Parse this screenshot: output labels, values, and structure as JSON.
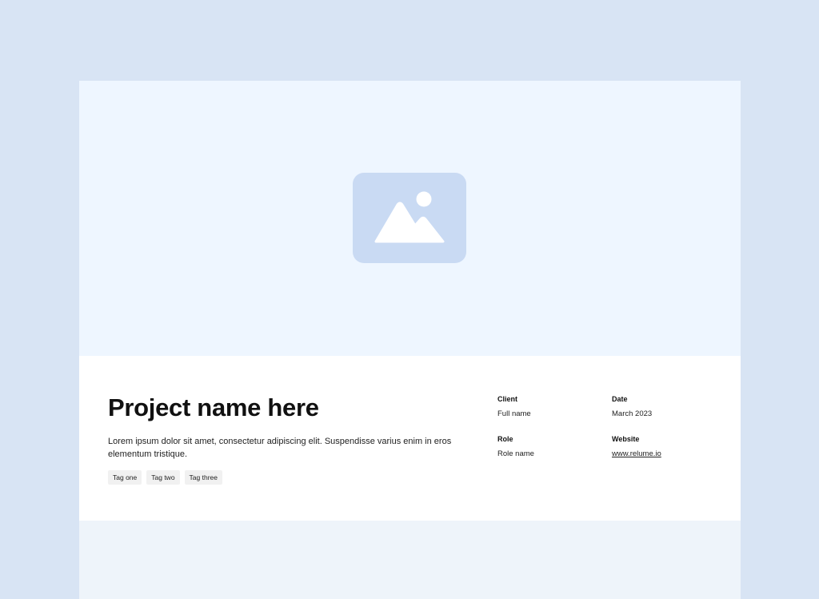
{
  "project": {
    "title": "Project name here",
    "description": "Lorem ipsum dolor sit amet, consectetur adipiscing elit. Suspendisse varius enim in eros elementum tristique.",
    "tags": [
      "Tag one",
      "Tag two",
      "Tag three"
    ]
  },
  "meta": {
    "client_label": "Client",
    "client_value": "Full name",
    "date_label": "Date",
    "date_value": "March 2023",
    "role_label": "Role",
    "role_value": "Role name",
    "website_label": "Website",
    "website_value": "www.relume.io"
  },
  "icons": {
    "hero": "image-placeholder-icon"
  },
  "colors": {
    "page_background": "#d8e4f4",
    "hero_background": "#eef6ff",
    "placeholder_tile": "#c9daf3",
    "tag_background": "#f1f1f1",
    "footer_band": "#eef4fa"
  }
}
